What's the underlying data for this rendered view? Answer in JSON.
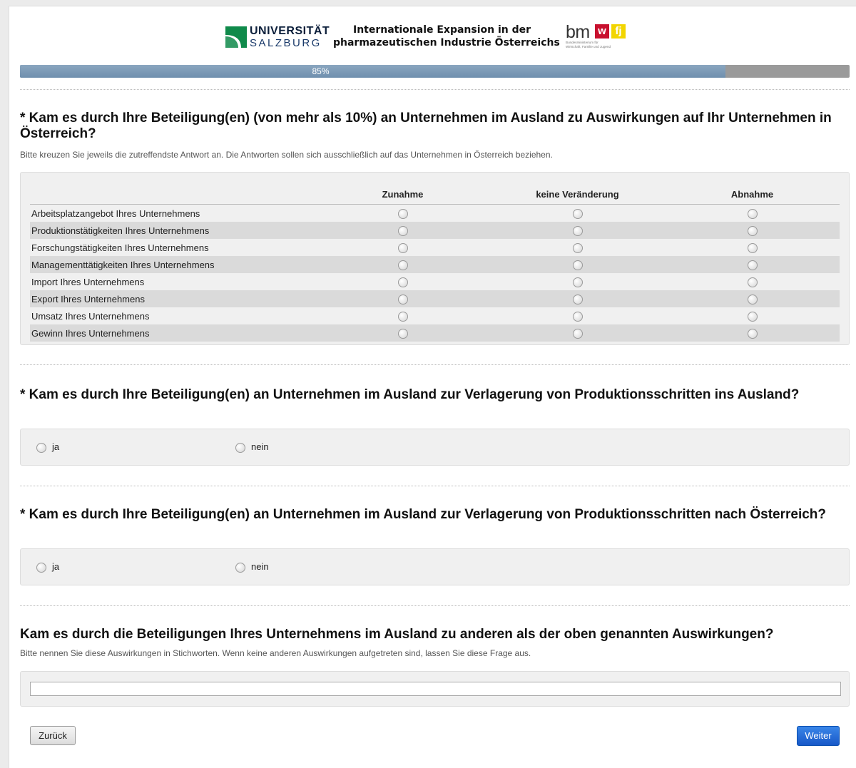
{
  "header": {
    "uni_line1": "UNIVERSITÄT",
    "uni_line2": "SALZBURG",
    "title_line1": "Internationale Expansion in der",
    "title_line2": "pharmazeutischen Industrie Österreichs",
    "bm_text": "bm",
    "bm_w": "w",
    "bm_fj": "fj",
    "bm_sub_line1": "Bundesministerium für",
    "bm_sub_line2": "Wirtschaft, Familie und Jugend",
    "colors": {
      "uni_green": "#0f8a4a",
      "bm_red": "#c8102e",
      "bm_yellow": "#f2d500"
    }
  },
  "progress": {
    "label": "85%",
    "fraction": 0.85
  },
  "q1": {
    "title": "* Kam es durch Ihre Beteiligung(en) (von mehr als 10%) an Unternehmen im Ausland zu Auswirkungen auf Ihr Unternehmen in Österreich?",
    "hint": "Bitte kreuzen Sie jeweils die zutreffendste Antwort an. Die Antworten sollen sich ausschließlich auf das Unternehmen in Österreich beziehen.",
    "columns": [
      "Zunahme",
      "keine Veränderung",
      "Abnahme"
    ],
    "rows": [
      "Arbeitsplatzangebot Ihres Unternehmens",
      "Produktionstätigkeiten Ihres Unternehmens",
      "Forschungstätigkeiten Ihres Unternehmens",
      "Managementtätigkeiten Ihres Unternehmens",
      "Import Ihres Unternehmens",
      "Export Ihres Unternehmens",
      "Umsatz Ihres Unternehmens",
      "Gewinn Ihres Unternehmens"
    ]
  },
  "q2": {
    "title": "* Kam es durch Ihre Beteiligung(en) an Unternehmen im Ausland zur Verlagerung von Produktionsschritten ins Ausland?",
    "options": [
      "ja",
      "nein"
    ]
  },
  "q3": {
    "title": "* Kam es durch Ihre Beteiligung(en) an Unternehmen im Ausland zur Verlagerung von Produktionsschritten nach Österreich?",
    "options": [
      "ja",
      "nein"
    ]
  },
  "q4": {
    "title": "Kam es durch die Beteiligungen Ihres Unternehmens im Ausland zu anderen als der oben genannten Auswirkungen?",
    "hint": "Bitte nennen Sie diese Auswirkungen in Stichworten. Wenn keine anderen Auswirkungen aufgetreten sind, lassen Sie diese Frage aus.",
    "value": ""
  },
  "nav": {
    "back_label": "Zurück",
    "next_label": "Weiter"
  }
}
